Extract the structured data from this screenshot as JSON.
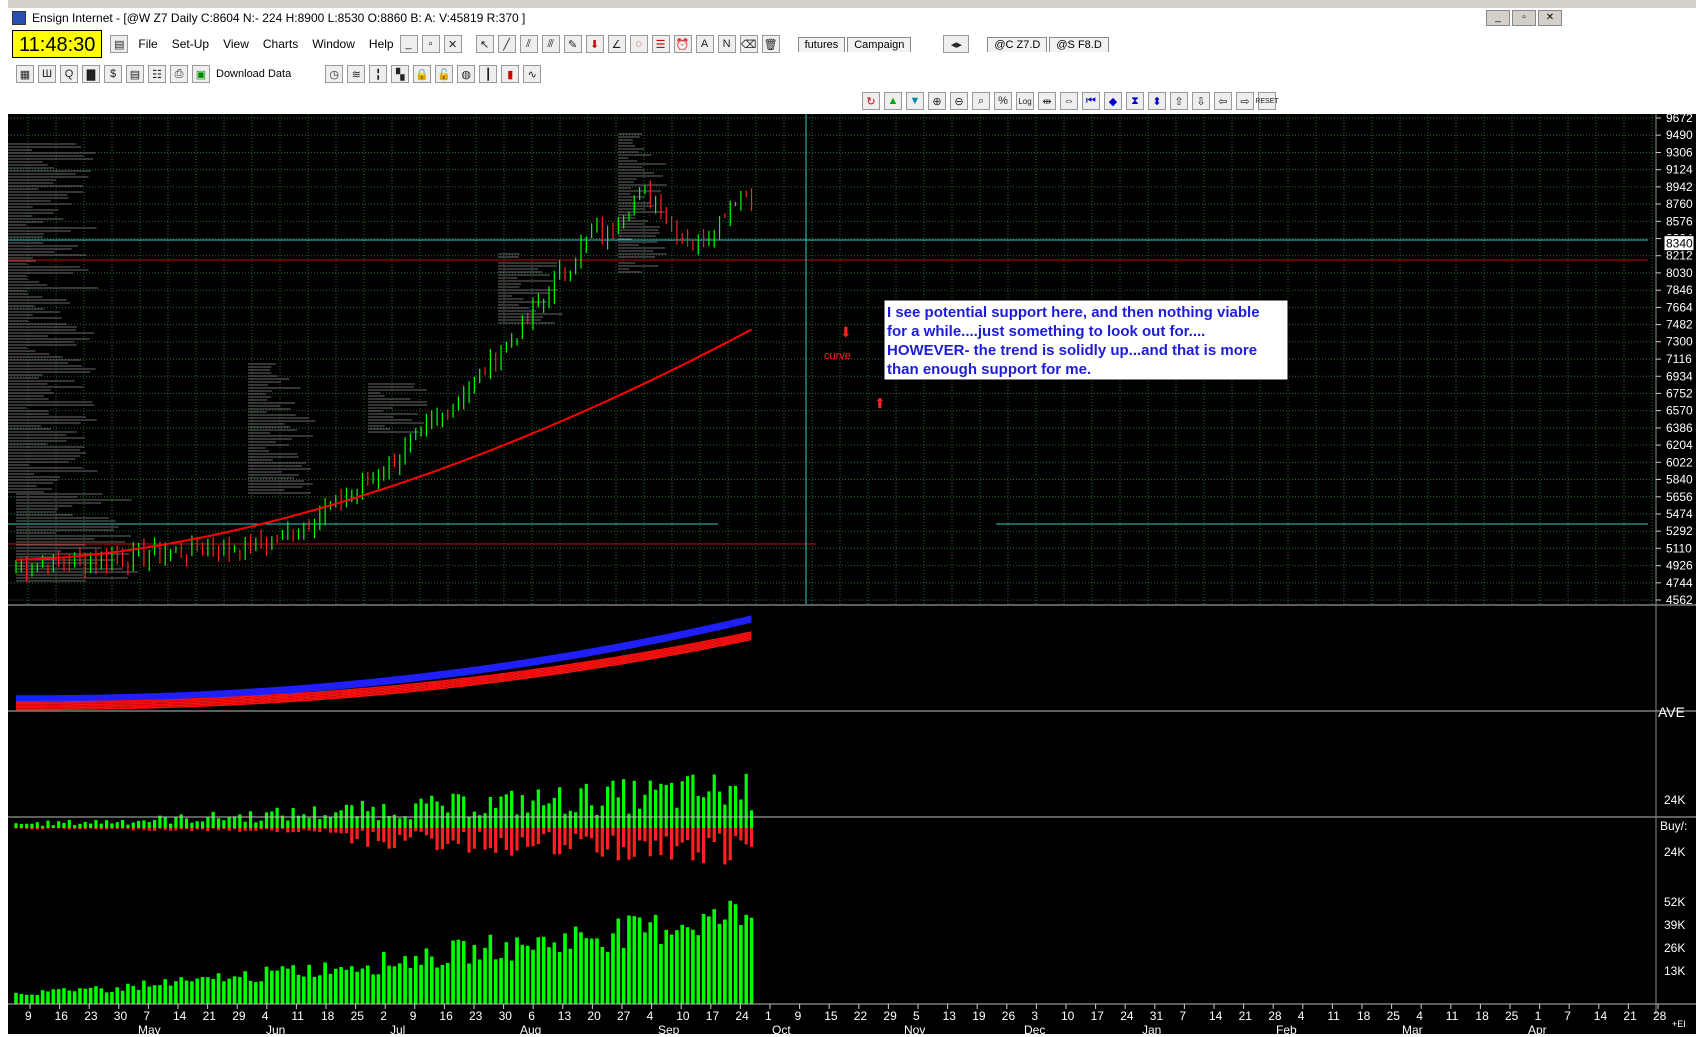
{
  "window": {
    "title": "Ensign Internet - [@W Z7 Daily C:8604 N:- 224 H:8900 L:8530 O:8860 B: A: V:45819 R:370 ]",
    "minimize": "0",
    "restore": "1",
    "close": "r"
  },
  "clock": "11:48:30",
  "menu": [
    "File",
    "Set-Up",
    "View",
    "Charts",
    "Window",
    "Help"
  ],
  "tabs_left": [
    "futures",
    "Campaign"
  ],
  "tabs_right": [
    "@C Z7.D",
    "@S F8.D"
  ],
  "toolbar2": {
    "download_label": "Download Data"
  },
  "price_axis": {
    "ticks": [
      "9672",
      "9490",
      "9306",
      "9124",
      "8942",
      "8760",
      "8576",
      "8394",
      "8212",
      "8030",
      "7846",
      "7664",
      "7482",
      "7300",
      "7116",
      "6934",
      "6752",
      "6570",
      "6386",
      "6204",
      "6022",
      "5840",
      "5656",
      "5474",
      "5292",
      "5110",
      "4926",
      "4744",
      "4562"
    ],
    "current_marker": "8340"
  },
  "annotation": {
    "lines": [
      "I see potential support here, and then nothing viable",
      "for a while....just something to look out for....",
      "HOWEVER- the trend is solidly up...and that is more",
      "than enough support for me."
    ],
    "curve_label": "curve"
  },
  "pane_labels": {
    "ave": "AVE",
    "buysell_top": "24K",
    "buysell_mid": "Buy/:",
    "buysell_bottom": "24K",
    "vol_ticks": [
      "52K",
      "39K",
      "26K",
      "13K"
    ]
  },
  "date_axis": {
    "days": [
      "9",
      "16",
      "23",
      "30",
      "7",
      "14",
      "21",
      "29",
      "4",
      "11",
      "18",
      "25",
      "2",
      "9",
      "16",
      "23",
      "30",
      "6",
      "13",
      "20",
      "27",
      "4",
      "10",
      "17",
      "24",
      "1",
      "9",
      "15",
      "22",
      "29",
      "5",
      "13",
      "19",
      "26",
      "3",
      "10",
      "17",
      "24",
      "31",
      "7",
      "14",
      "21",
      "28",
      "4",
      "11",
      "18",
      "25",
      "4",
      "11",
      "18",
      "25",
      "1",
      "7",
      "14",
      "21",
      "28"
    ],
    "months": [
      "May",
      "Jun",
      "Jul",
      "Aug",
      "Sep",
      "Oct",
      "Nov",
      "Dec",
      "Jan",
      "Feb",
      "Mar",
      "Apr"
    ],
    "corner": "+EI"
  },
  "colors": {
    "up_bar": "#00ff00",
    "down_bar": "#ff2020",
    "ma_red": "#ff0000",
    "cyan": "#33cccc",
    "grid": "#2d6a2d"
  }
}
